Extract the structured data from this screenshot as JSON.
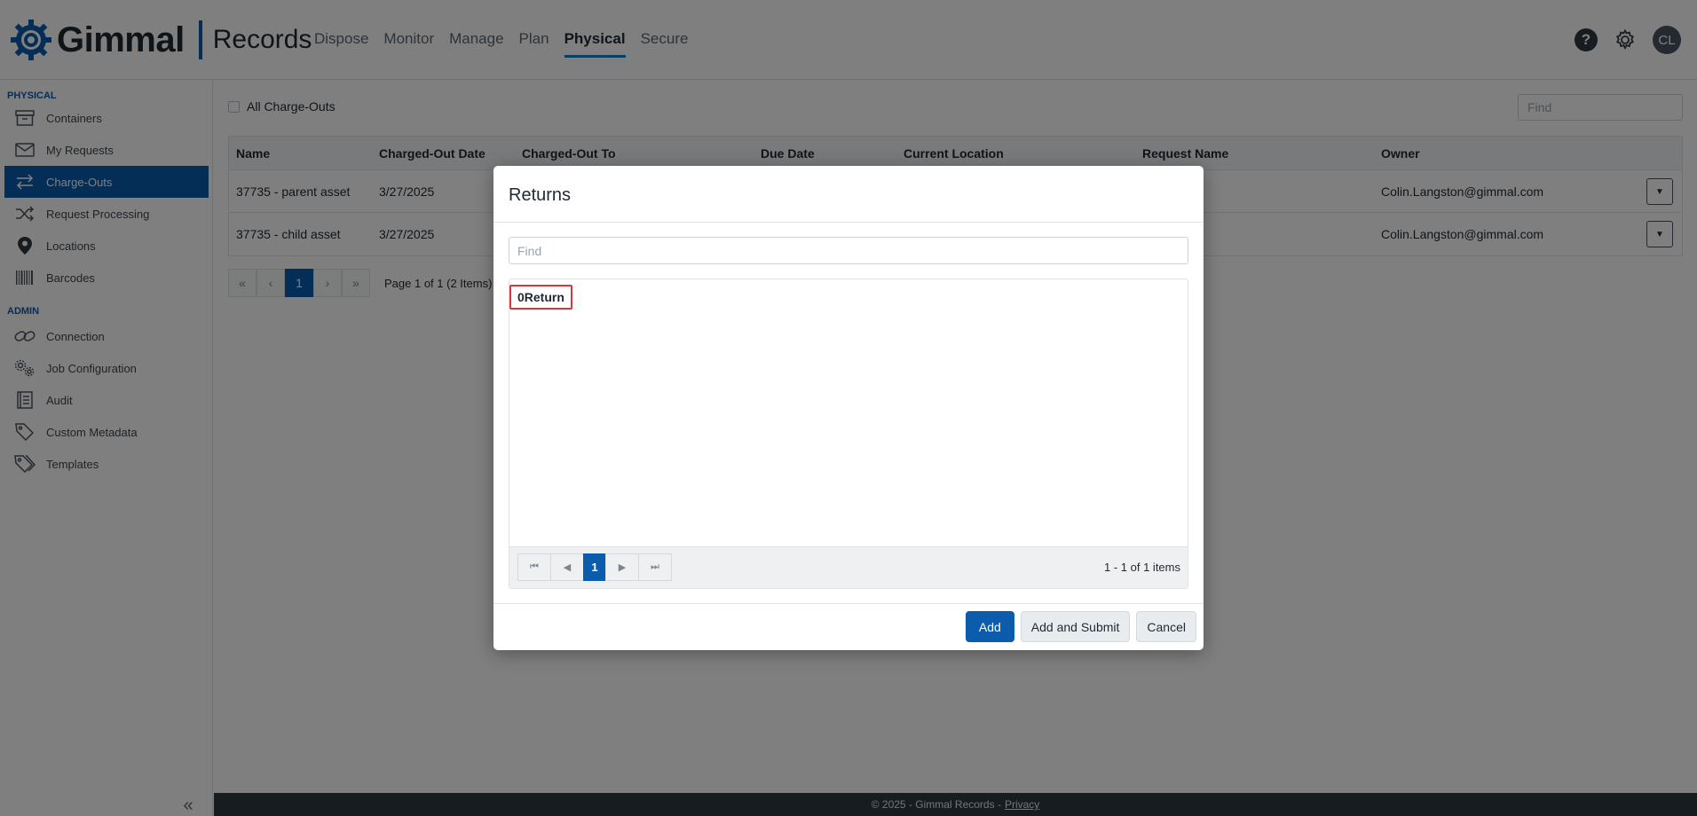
{
  "app": {
    "brand": "Gimmal",
    "product": "Records"
  },
  "nav": {
    "items": [
      {
        "label": "Dispose"
      },
      {
        "label": "Monitor"
      },
      {
        "label": "Manage"
      },
      {
        "label": "Plan"
      },
      {
        "label": "Physical",
        "active": true
      },
      {
        "label": "Secure"
      }
    ]
  },
  "header": {
    "help_icon": "?",
    "settings_icon": "gear-icon",
    "avatar_initials": "CL"
  },
  "sidebar": {
    "physical_section": "PHYSICAL",
    "physical_items": [
      {
        "label": "Containers",
        "icon": "archive-box-icon"
      },
      {
        "label": "My Requests",
        "icon": "envelope-icon"
      },
      {
        "label": "Charge-Outs",
        "icon": "arrows-exchange-icon",
        "active": true
      },
      {
        "label": "Request Processing",
        "icon": "shuffle-icon"
      },
      {
        "label": "Locations",
        "icon": "map-pin-icon"
      },
      {
        "label": "Barcodes",
        "icon": "barcode-icon"
      }
    ],
    "admin_section": "ADMIN",
    "admin_items": [
      {
        "label": "Connection",
        "icon": "link-icon"
      },
      {
        "label": "Job Configuration",
        "icon": "gears-icon"
      },
      {
        "label": "Audit",
        "icon": "ledger-icon"
      },
      {
        "label": "Custom Metadata",
        "icon": "tag-icon"
      },
      {
        "label": "Templates",
        "icon": "tags-icon"
      }
    ],
    "collapse_glyph": "«"
  },
  "main": {
    "all_chargeouts_label": "All Charge-Outs",
    "find_placeholder": "Find",
    "columns": [
      "Name",
      "Charged-Out Date",
      "Charged-Out To",
      "Due Date",
      "Current Location",
      "Request Name",
      "Owner"
    ],
    "rows": [
      {
        "name": "37735 - parent asset",
        "date": "3/27/2025",
        "to": "",
        "due": "",
        "location": "",
        "request": "",
        "owner": "Colin.Langston@gimmal.com"
      },
      {
        "name": "37735 - child asset",
        "date": "3/27/2025",
        "to": "",
        "due": "",
        "location": "",
        "request": "",
        "owner": "Colin.Langston@gimmal.com"
      }
    ],
    "pager": {
      "first": "«",
      "prev": "‹",
      "current": "1",
      "next": "›",
      "last": "»",
      "info": "Page 1 of 1 (2 Items)"
    }
  },
  "footer": {
    "text": "© 2025 - Gimmal Records -",
    "privacy": "Privacy"
  },
  "modal": {
    "title": "Returns",
    "find_placeholder": "Find",
    "list_items": [
      "0Return"
    ],
    "pager": {
      "first": "⏮",
      "prev": "◀",
      "current": "1",
      "next": "▶",
      "last": "⏭",
      "info": "1 - 1 of 1 items"
    },
    "buttons": {
      "add": "Add",
      "add_and_submit": "Add and Submit",
      "cancel": "Cancel"
    }
  }
}
